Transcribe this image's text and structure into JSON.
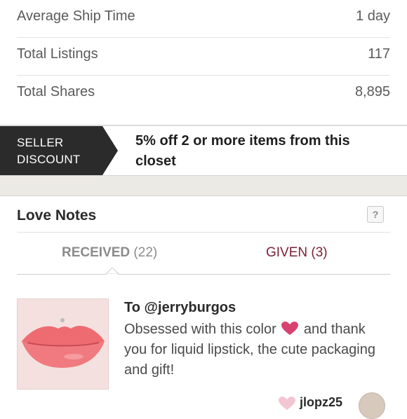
{
  "stats": [
    {
      "label": "Average Ship Time",
      "value": "1 day"
    },
    {
      "label": "Total Listings",
      "value": "117"
    },
    {
      "label": "Total Shares",
      "value": "8,895"
    }
  ],
  "discount": {
    "badge_line1": "SELLER",
    "badge_line2": "DISCOUNT",
    "message": "5% off 2 or more items from this closet",
    "badge_color": "#2b2b2b"
  },
  "love_notes": {
    "title": "Love Notes",
    "help_label": "?",
    "tabs": {
      "received_label": "RECEIVED",
      "received_count": "(22)",
      "given_label": "GIVEN (3)"
    },
    "notes": [
      {
        "to": "To @jerryburgos",
        "text_part1": "Obsessed with this color",
        "text_part2": "and thank you for liquid lipstick, the cute packaging and gift!",
        "from": "jlopz25"
      }
    ]
  },
  "colors": {
    "accent": "#7a2238",
    "heart": "#d8426e"
  }
}
